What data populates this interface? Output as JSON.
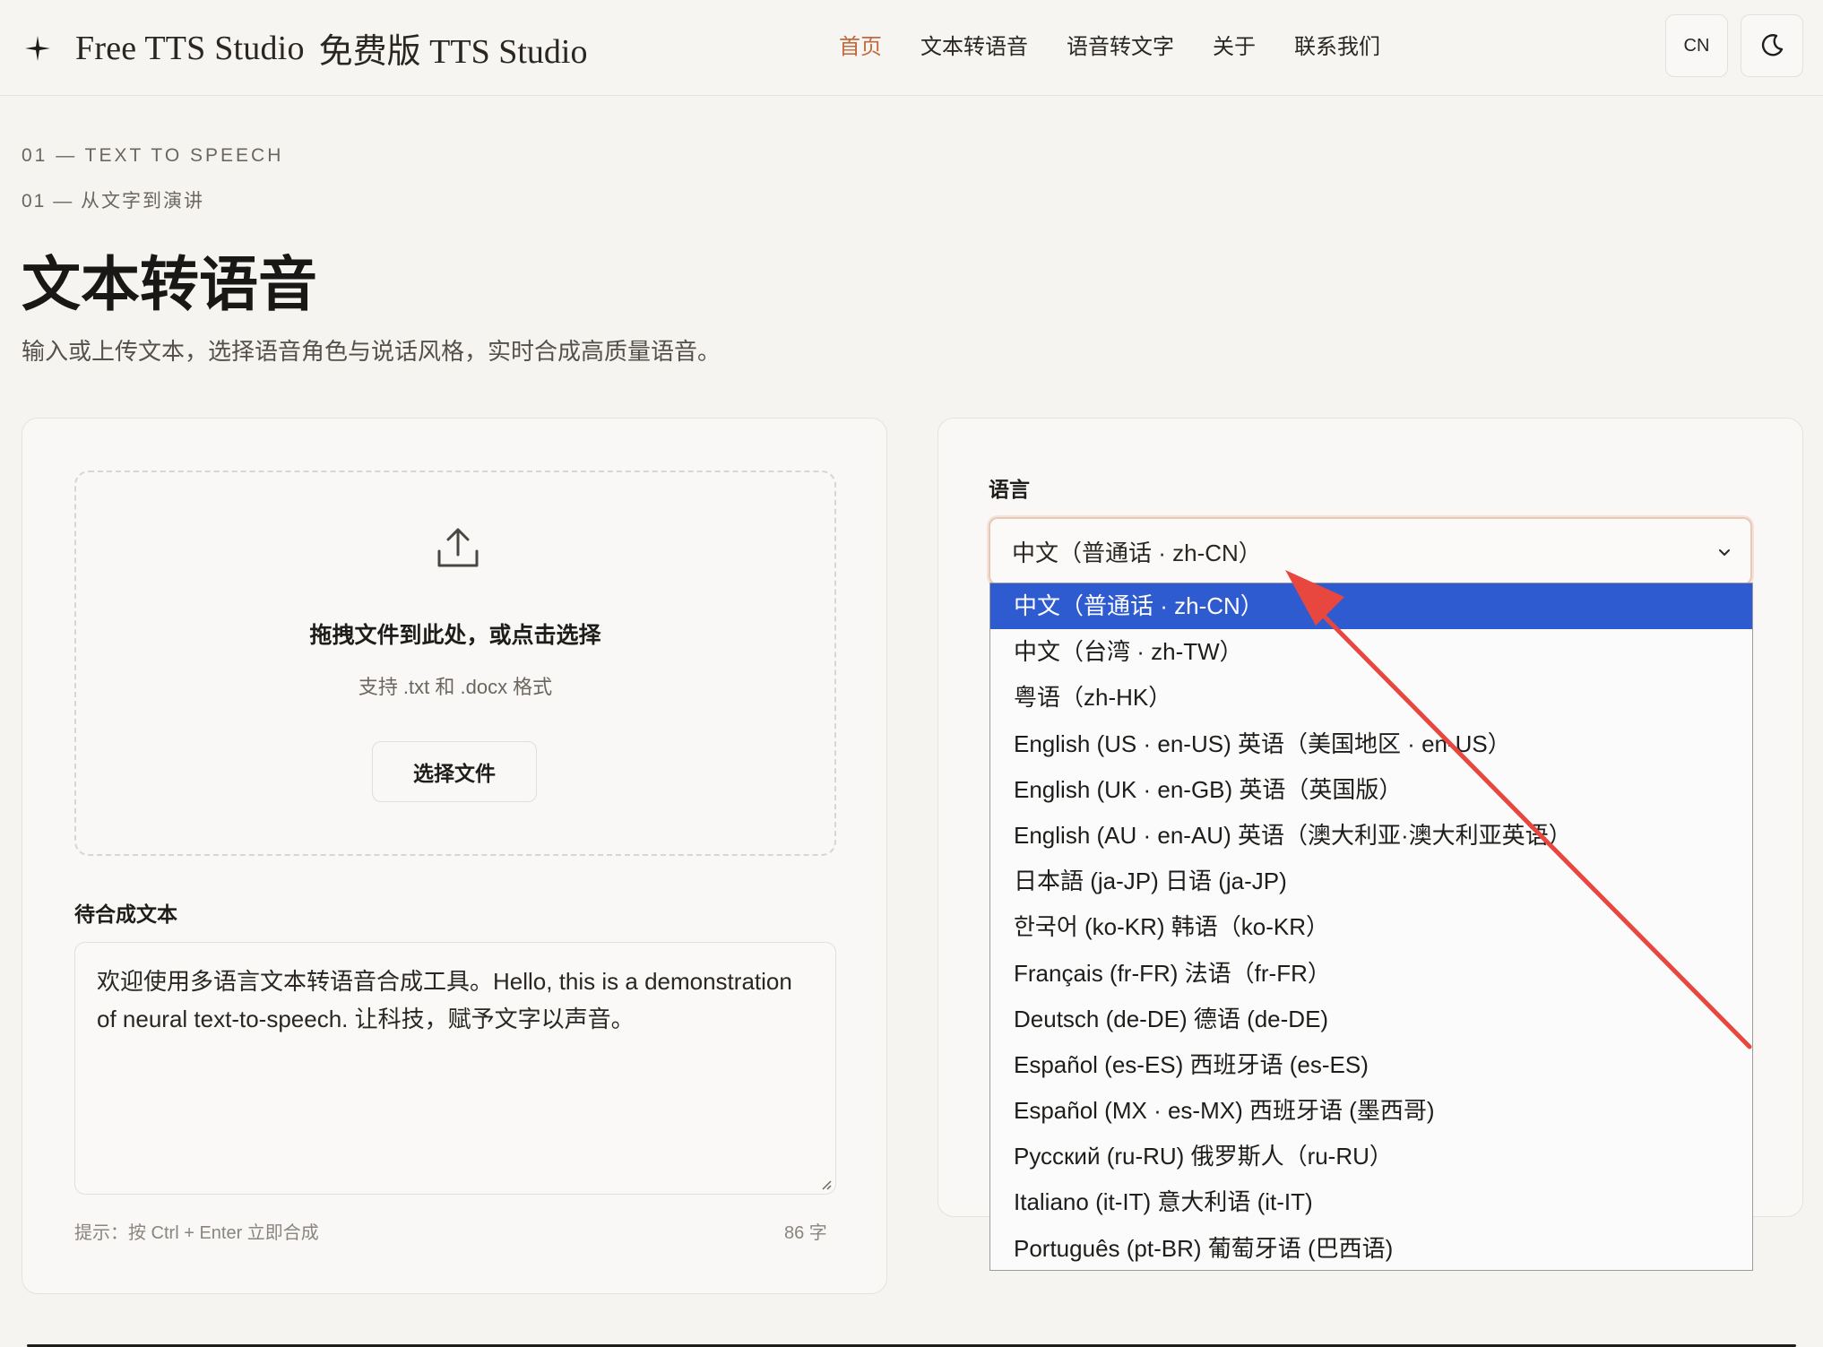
{
  "header": {
    "brand_icon": "sparkle-icon",
    "brand_en": "Free TTS Studio",
    "brand_cn": "免费版 TTS Studio",
    "nav": [
      {
        "label": "首页",
        "active": true
      },
      {
        "label": "文本转语音",
        "active": false
      },
      {
        "label": "语音转文字",
        "active": false
      },
      {
        "label": "关于",
        "active": false
      },
      {
        "label": "联系我们",
        "active": false
      }
    ],
    "lang_toggle": "CN",
    "theme_icon": "moon-icon"
  },
  "hero": {
    "eyebrow_en": "01 — TEXT TO SPEECH",
    "eyebrow_cn": "01 — 从文字到演讲",
    "title": "文本转语音",
    "description": "输入或上传文本，选择语音角色与说话风格，实时合成高质量语音。"
  },
  "upload": {
    "icon": "upload-icon",
    "title": "拖拽文件到此处，或点击选择",
    "hint": "支持 .txt 和 .docx 格式",
    "button": "选择文件"
  },
  "text_input": {
    "label": "待合成文本",
    "value": "欢迎使用多语言文本转语音合成工具。Hello, this is a demonstration of neural text-to-speech. 让科技，赋予文字以声音。",
    "tip": "提示：按 Ctrl + Enter 立即合成",
    "char_count": "86 字"
  },
  "language": {
    "label": "语言",
    "selected": "中文（普通话 · zh-CN）",
    "options": [
      "中文（普通话 · zh-CN）",
      "中文（台湾 · zh-TW）",
      "粤语（zh-HK）",
      "English (US · en-US)  英语（美国地区 · en-US）",
      "English (UK · en-GB)  英语（英国版）",
      "English (AU · en-AU)  英语（澳大利亚·澳大利亚英语）",
      "日本語 (ja-JP)  日语 (ja-JP)",
      "한국어 (ko-KR)  韩语（ko-KR）",
      "Français (fr-FR)  法语（fr-FR）",
      "Deutsch (de-DE)  德语 (de-DE)",
      "Español (es-ES)  西班牙语 (es-ES)",
      "Español (MX · es-MX)  西班牙语 (墨西哥)",
      "Русский (ru-RU)  俄罗斯人（ru-RU）",
      "Italiano (it-IT)  意大利语 (it-IT)",
      "Português (pt-BR)  葡萄牙语 (巴西语)"
    ]
  },
  "colors": {
    "accent": "#c26a3d",
    "highlight": "#2f5bd1",
    "annotation_arrow": "#e8473f"
  }
}
